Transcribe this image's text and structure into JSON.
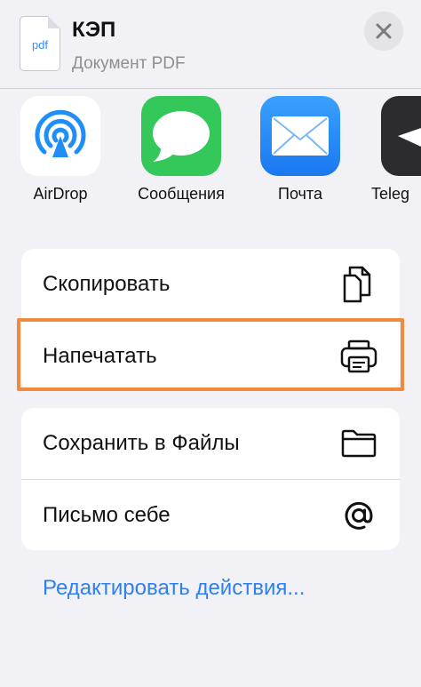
{
  "header": {
    "file_ext": "pdf",
    "title": "КЭП",
    "subtitle": "Документ PDF"
  },
  "apps": [
    {
      "label": "AirDrop",
      "icon": "airdrop-icon"
    },
    {
      "label": "Сообщения",
      "icon": "messages-icon"
    },
    {
      "label": "Почта",
      "icon": "mail-icon"
    },
    {
      "label": "Teleg",
      "icon": "telegram-icon"
    }
  ],
  "actions_group1": [
    {
      "label": "Скопировать",
      "icon": "copy-icon"
    },
    {
      "label": "Напечатать",
      "icon": "printer-icon"
    }
  ],
  "actions_group2": [
    {
      "label": "Сохранить в Файлы",
      "icon": "folder-icon"
    },
    {
      "label": "Письмо себе",
      "icon": "at-icon"
    }
  ],
  "edit_actions": "Редактировать действия...",
  "colors": {
    "highlight": "#f28a3d",
    "link": "#2f7ff0",
    "messages": "#34c759",
    "mail": "#1f8ef6"
  }
}
